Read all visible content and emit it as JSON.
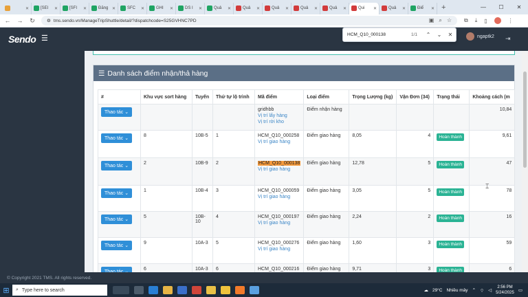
{
  "browser": {
    "tabs": [
      {
        "label": "",
        "color": "#e8a13a"
      },
      {
        "label": "[SEI",
        "color": "#1fa463"
      },
      {
        "label": "[SFI",
        "color": "#1fa463"
      },
      {
        "label": "Đăng",
        "color": "#1fa463"
      },
      {
        "label": "SFC",
        "color": "#1fa463"
      },
      {
        "label": "GHI",
        "color": "#1fa463"
      },
      {
        "label": "DS I",
        "color": "#1fa463"
      },
      {
        "label": "Quả",
        "color": "#1fa463"
      },
      {
        "label": "Quả",
        "color": "#d23b3b"
      },
      {
        "label": "Quả",
        "color": "#d23b3b"
      },
      {
        "label": "Quả",
        "color": "#d23b3b"
      },
      {
        "label": "Quả",
        "color": "#d23b3b"
      },
      {
        "label": "Qui",
        "color": "#d23b3b",
        "active": true
      },
      {
        "label": "Quả",
        "color": "#d23b3b"
      },
      {
        "label": "Điể",
        "color": "#1fa463"
      }
    ],
    "url": "tms.sendo.vn/ManageTripShuttle/detail/?dispatchcode=S25GVHNC7PD",
    "find": {
      "query": "HCM_Q10_000138",
      "count": "1/1"
    }
  },
  "app": {
    "logo": "Sendo",
    "user": "ngaptk2",
    "panel_title": "Danh sách điểm nhận/thả hàng",
    "columns": [
      "#",
      "Khu vực sort hàng",
      "Tuyến",
      "Thứ tự lộ trình",
      "Mã điểm",
      "Loại điểm",
      "Trọng Lượng (kg)",
      "Vận Đơn (34)",
      "Trạng thái",
      "Khoảng cách (m"
    ],
    "action_label": "Thao tác",
    "rows": [
      {
        "zone": "",
        "route": "",
        "order": "",
        "code": "gridhbb",
        "links": [
          "Vị trí lấy hàng",
          "Vị trí rời kho"
        ],
        "type": "Điểm nhận hàng",
        "weight": "",
        "orders": "",
        "status": "",
        "distance": "10,84",
        "highlight": false
      },
      {
        "zone": "8",
        "route": "10B-5",
        "order": "1",
        "code": "HCM_Q10_000258",
        "links": [
          "Vị trí giao hàng"
        ],
        "type": "Điểm giao hàng",
        "weight": "8,05",
        "orders": "4",
        "status": "Hoàn thành",
        "distance": "9,61",
        "highlight": false
      },
      {
        "zone": "2",
        "route": "10B-9",
        "order": "2",
        "code": "HCM_Q10_000138",
        "links": [
          "Vị trí giao hàng"
        ],
        "type": "Điểm giao hàng",
        "weight": "12,78",
        "orders": "5",
        "status": "Hoàn thành",
        "distance": "47",
        "highlight": true
      },
      {
        "zone": "1",
        "route": "10B-4",
        "order": "3",
        "code": "HCM_Q10_000059",
        "links": [
          "Vị trí giao hàng"
        ],
        "type": "Điểm giao hàng",
        "weight": "3,05",
        "orders": "5",
        "status": "Hoàn thành",
        "distance": "78",
        "highlight": false
      },
      {
        "zone": "5",
        "route": "10B-10",
        "order": "4",
        "code": "HCM_Q10_000197",
        "links": [
          "Vị trí giao hàng"
        ],
        "type": "Điểm giao hàng",
        "weight": "2,24",
        "orders": "2",
        "status": "Hoàn thành",
        "distance": "16",
        "highlight": false
      },
      {
        "zone": "9",
        "route": "10A-3",
        "order": "5",
        "code": "HCM_Q10_000276",
        "links": [
          "Vị trí giao hàng"
        ],
        "type": "Điểm giao hàng",
        "weight": "1,60",
        "orders": "3",
        "status": "Hoàn thành",
        "distance": "59",
        "highlight": false
      },
      {
        "zone": "6",
        "route": "10A-3",
        "order": "6",
        "code": "HCM_Q10_000216",
        "links": [],
        "type": "Điểm giao hàng",
        "weight": "9,71",
        "orders": "3",
        "status": "Hoàn thành",
        "distance": "6",
        "highlight": false
      }
    ],
    "footer": "© Copyright 2021 TMS. All rights reserved."
  },
  "taskbar": {
    "search_placeholder": "Type here to search",
    "weather_temp": "29°C",
    "weather_text": "Nhiều mây",
    "time": "2:56 PM",
    "date": "5/24/2025"
  }
}
